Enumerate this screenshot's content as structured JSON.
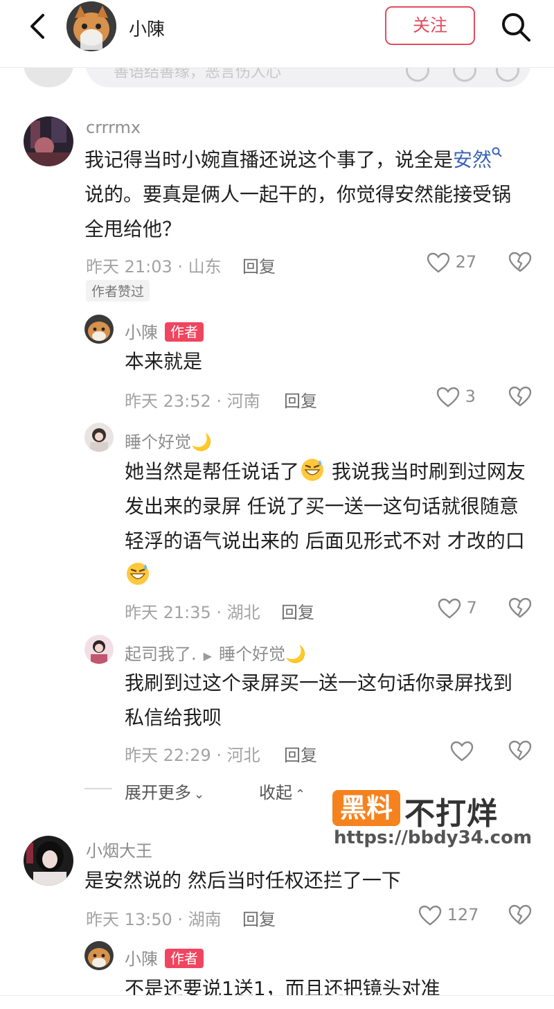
{
  "header": {
    "title": "小陳",
    "follow_label": "关注"
  },
  "peek": {
    "placeholder": "善语结善缘，恶言伤人心"
  },
  "comments": [
    {
      "user": "crrrmx",
      "text_a": "我记得当时小婉直播还说这个事了，说全是",
      "text_link": "安然",
      "text_b": "说的。要真是俩人一起干的，你觉得安然能接受锅全甩给他？",
      "meta": "昨天 21:03 · 山东",
      "reply_label": "回复",
      "likes": "27",
      "chip": "作者赞过"
    },
    {
      "user": "小陳",
      "badge": "作者",
      "text": "本来就是",
      "meta": "昨天 23:52 · 河南",
      "reply_label": "回复",
      "likes": "3"
    },
    {
      "user": "睡个好觉🌙",
      "text_a": "她当然是帮任说话了",
      "text_b": " 我说我当时刷到过网友发出来的录屏 任说了买一送一这句话就很随意轻浮的语气说出来的 后面见形式不对 才改的口",
      "meta": "昨天 21:35 · 湖北",
      "reply_label": "回复",
      "likes": "7"
    },
    {
      "user": "起司我了.",
      "reply_to": "睡个好觉🌙",
      "text": "我刷到过这个录屏买一送一这句话你录屏找到 私信给我呗",
      "meta": "昨天 22:29 · 河北",
      "reply_label": "回复",
      "likes": ""
    },
    {
      "user": "小烟大王",
      "text": "是安然说的 然后当时任权还拦了一下",
      "meta": "昨天 13:50 · 湖南",
      "reply_label": "回复",
      "likes": "127"
    },
    {
      "user": "小陳",
      "badge": "作者",
      "text": "不是还要说1送1，而且还把镜头对准"
    }
  ],
  "thread": {
    "expand_label": "展开更多",
    "collapse_label": "收起"
  },
  "watermark": {
    "box": "黑料",
    "title": "不打烊",
    "url": "https://bbdy34.com"
  },
  "colors": {
    "accent": "#e14b5f",
    "badge": "#f0455f",
    "link": "#3b63b8",
    "watermark_orange": "#f5821f"
  }
}
